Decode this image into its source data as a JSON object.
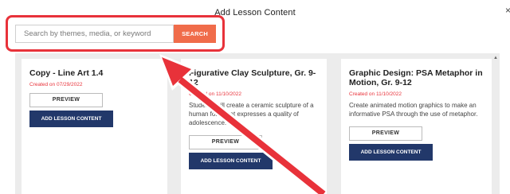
{
  "modal": {
    "title": "Add Lesson Content",
    "close_label": "×"
  },
  "search": {
    "placeholder": "Search by themes, media, or keyword",
    "value": "",
    "button_label": "SEARCH"
  },
  "cards": [
    {
      "title": "Copy - Line Art 1.4",
      "date": "Created on 07/29/2022",
      "description": "",
      "preview_label": "PREVIEW",
      "add_label": "ADD LESSON CONTENT"
    },
    {
      "title": "Figurative Clay Sculpture, Gr. 9-12",
      "date": "Created on 11/10/2022",
      "description": "Students will create a ceramic sculpture of a human form that expresses a quality of adolescence.",
      "preview_label": "PREVIEW",
      "add_label": "ADD LESSON CONTENT"
    },
    {
      "title": "Graphic Design: PSA Metaphor in Motion, Gr. 9-12",
      "date": "Created on 11/10/2022",
      "description": "Create animated motion graphics to make an informative PSA through the use of metaphor.",
      "preview_label": "PREVIEW",
      "add_label": "ADD LESSON CONTENT"
    }
  ],
  "colors": {
    "accent_red": "#e8323a",
    "search_button": "#f06c4a",
    "primary_navy": "#22386a",
    "panel_gray": "#ececec"
  },
  "icons": {
    "scroll_up": "chevron-up-icon",
    "annotation": "red-arrow-icon"
  }
}
